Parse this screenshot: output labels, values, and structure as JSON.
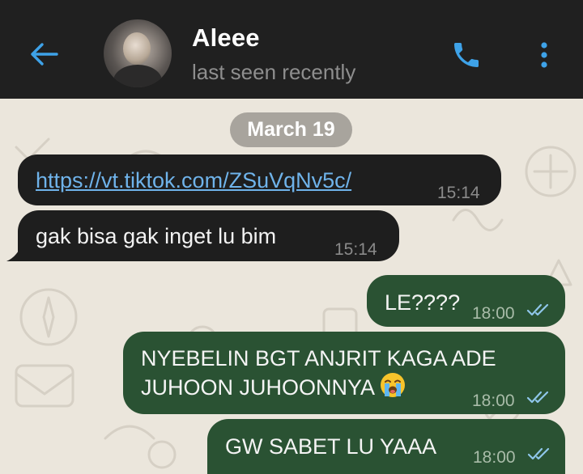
{
  "header": {
    "contact_name": "Aleee",
    "status": "last seen recently",
    "icons": {
      "back": "arrow-left-icon",
      "call": "phone-icon",
      "menu": "more-vertical-icon"
    },
    "accent_color": "#3ea2e8"
  },
  "chat": {
    "date_separator": "March 19",
    "messages": [
      {
        "direction": "incoming",
        "text": "https://vt.tiktok.com/ZSuVqNv5c/",
        "time": "15:14",
        "is_link": true
      },
      {
        "direction": "incoming",
        "text": "gak bisa gak inget lu bim",
        "time": "15:14"
      },
      {
        "direction": "outgoing",
        "text": "LE????",
        "time": "18:00",
        "status": "read"
      },
      {
        "direction": "outgoing",
        "text": "NYEBELIN BGT ANJRIT KAGA ADE JUHOON JUHOONNYA",
        "emoji": "loudly-crying-face",
        "time": "18:00",
        "status": "read"
      },
      {
        "direction": "outgoing",
        "text": "GW SABET LU YAAA",
        "time": "18:00",
        "status": "read"
      }
    ]
  },
  "colors": {
    "header_bg": "#202020",
    "incoming_bubble": "#1e1e1e",
    "outgoing_bubble": "#2a5233",
    "wallpaper": "#ebe6dc",
    "link": "#6fb3ea"
  }
}
